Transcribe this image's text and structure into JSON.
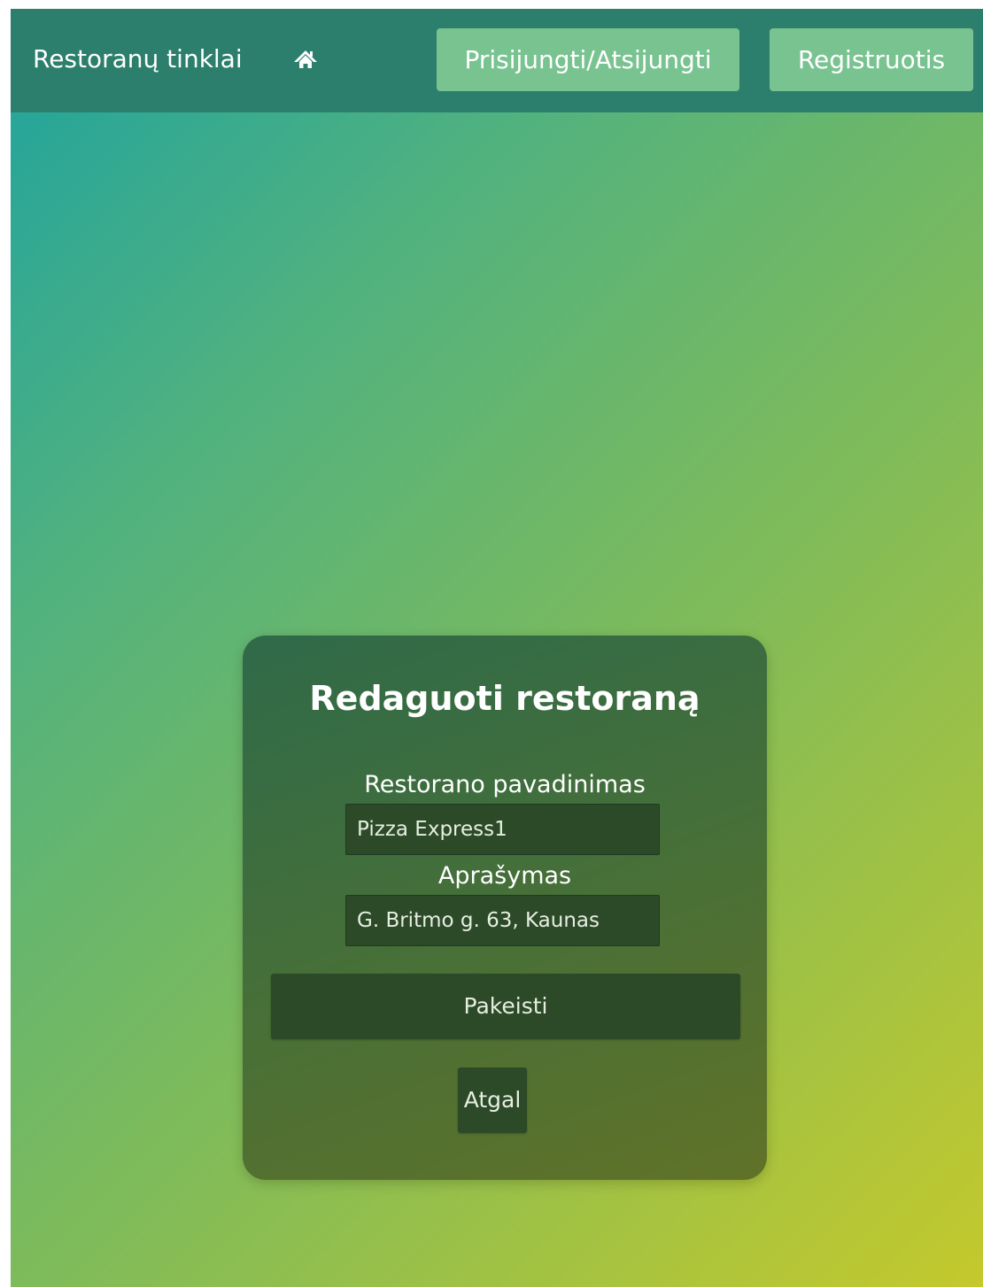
{
  "navbar": {
    "brand": "Restoranų tinklai",
    "home_icon": "home-icon",
    "login_label": "Prisijungti/Atsijungti",
    "register_label": "Registruotis",
    "bar_color": "#2b7f6c",
    "button_color": "#79c391"
  },
  "form": {
    "title": "Redaguoti restoraną",
    "name_label": "Restorano pavadinimas",
    "name_value": "Pizza Express1",
    "description_label": "Aprašymas",
    "description_value": "G. Britmo g. 63, Kaunas",
    "submit_label": "Pakeisti",
    "back_label": "Atgal"
  },
  "colors": {
    "background_gradient": [
      "#1ea39f",
      "#7fbb5a",
      "#c4c92c"
    ],
    "card": "#446f3a",
    "control": "#2c4a28"
  }
}
